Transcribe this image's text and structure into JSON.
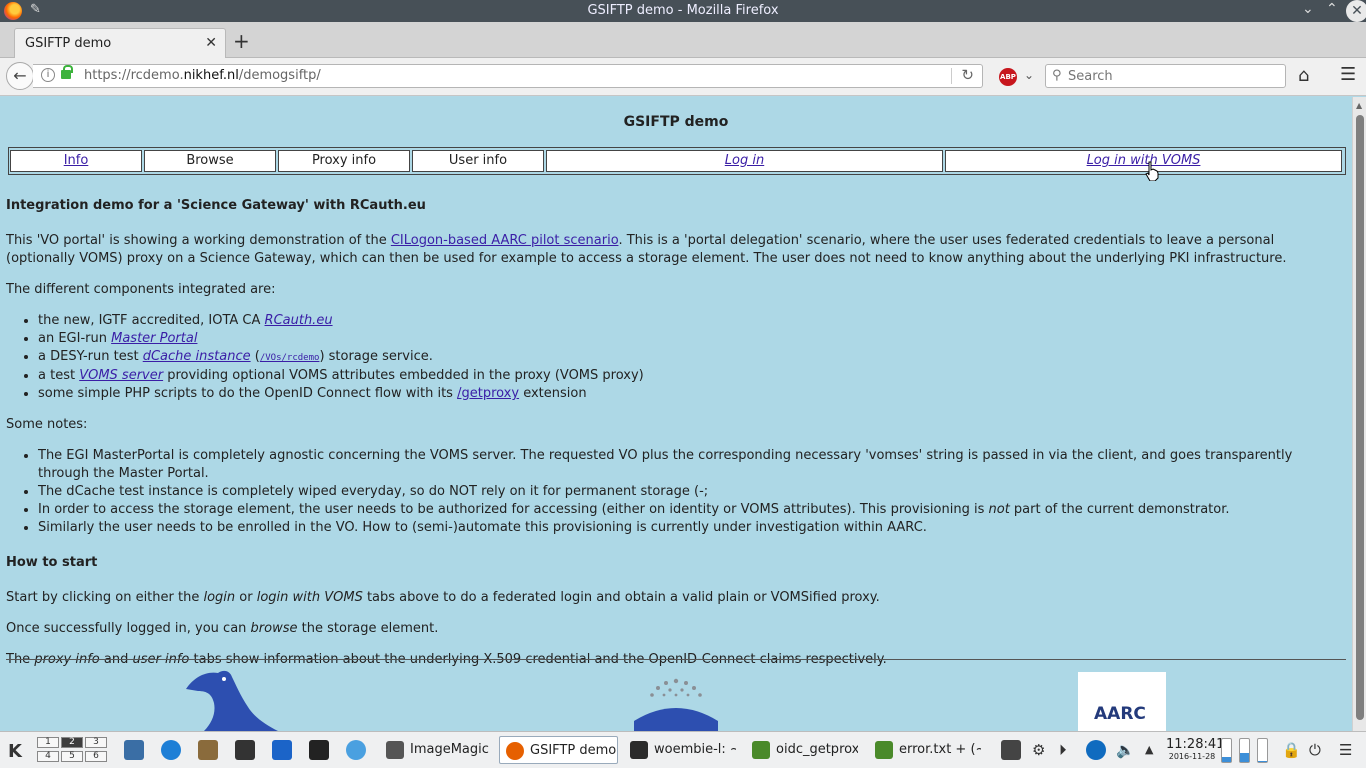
{
  "window": {
    "title": "GSIFTP demo - Mozilla Firefox"
  },
  "browser": {
    "tab_title": "GSIFTP demo",
    "url_prefix": "https://rcdemo.",
    "url_domain": "nikhef.nl",
    "url_suffix": "/demogsiftp/",
    "search_placeholder": "Search"
  },
  "page": {
    "title": "GSIFTP demo",
    "nav": [
      {
        "label": "Info",
        "link": true,
        "italic": false
      },
      {
        "label": "Browse",
        "link": false,
        "italic": false
      },
      {
        "label": "Proxy info",
        "link": false,
        "italic": false
      },
      {
        "label": "User info",
        "link": false,
        "italic": false
      },
      {
        "label": "Log in",
        "link": true,
        "italic": true
      },
      {
        "label": "Log in with VOMS",
        "link": true,
        "italic": true
      }
    ],
    "heading1": "Integration demo for a 'Science Gateway' with RCauth.eu",
    "intro": {
      "before": "This 'VO portal' is showing a working demonstration of the ",
      "link": "CILogon-based AARC pilot scenario",
      "after": ". This is a 'portal delegation' scenario, where the user uses federated credentials to leave a personal (optionally VOMS) proxy on a Science Gateway, which can then be used for example to access a storage element. The user does not need to know anything about the underlying PKI infrastructure."
    },
    "components_intro": "The different components integrated are:",
    "components": {
      "c1_text": "the new, IGTF accredited, IOTA CA ",
      "c1_link": "RCauth.eu",
      "c2_text": "an EGI-run ",
      "c2_link": "Master Portal",
      "c3_text": "a DESY-run test ",
      "c3_link": "dCache instance",
      "c3_mid": " (",
      "c3_code": "/VOs/rcdemo",
      "c3_after": ") storage service.",
      "c4_text": "a test ",
      "c4_link": "VOMS server",
      "c4_after": " providing optional VOMS attributes embedded in the proxy (VOMS proxy)",
      "c5_text": "some simple PHP scripts to do the OpenID Connect flow with its ",
      "c5_link": "/getproxy",
      "c5_after": " extension"
    },
    "notes_intro": "Some notes:",
    "notes": {
      "n1": "The EGI MasterPortal is completely agnostic concerning the VOMS server. The requested VO plus the corresponding necessary 'vomses' string is passed in via the client, and goes transparently through the Master Portal.",
      "n2": "The dCache test instance is completely wiped everyday, so do NOT rely on it for permanent storage (-;",
      "n3_before": "In order to access the storage element, the user needs to be authorized for accessing (either on identity or VOMS attributes). This provisioning is ",
      "n3_em": "not",
      "n3_after": " part of the current demonstrator.",
      "n4": "Similarly the user needs to be enrolled in the VO. How to (semi-)automate this provisioning is currently under investigation within AARC."
    },
    "heading2": "How to start",
    "start": {
      "p1_a": "Start by clicking on either the ",
      "p1_em1": "login",
      "p1_b": " or ",
      "p1_em2": "login with VOMS",
      "p1_c": " tabs above to do a federated login and obtain a valid plain or VOMSified proxy.",
      "p2_a": "Once successfully logged in, you can ",
      "p2_em": "browse",
      "p2_b": " the storage element.",
      "p3_a": "The ",
      "p3_em1": "proxy info",
      "p3_b": " and ",
      "p3_em2": "user info",
      "p3_c": " tabs show information about the underlying X.509 credential and the OpenID-Connect claims respectively."
    },
    "aarc_logo_text": "AARC"
  },
  "taskbar": {
    "pager": [
      "1",
      "2",
      "3",
      "4",
      "5",
      "6"
    ],
    "tasks": [
      {
        "label": "ImageMagick",
        "color": "#555555"
      },
      {
        "label": "GSIFTP demo",
        "color": "#e66000"
      },
      {
        "label": "woembie-l: ~",
        "color": "#2b2b2b"
      },
      {
        "label": "oidc_getprox",
        "color": "#4a8a2a"
      },
      {
        "label": "error.txt + (~",
        "color": "#4a8a2a"
      }
    ],
    "clock_time": "11:28:41",
    "clock_date": "2016-11-28"
  }
}
